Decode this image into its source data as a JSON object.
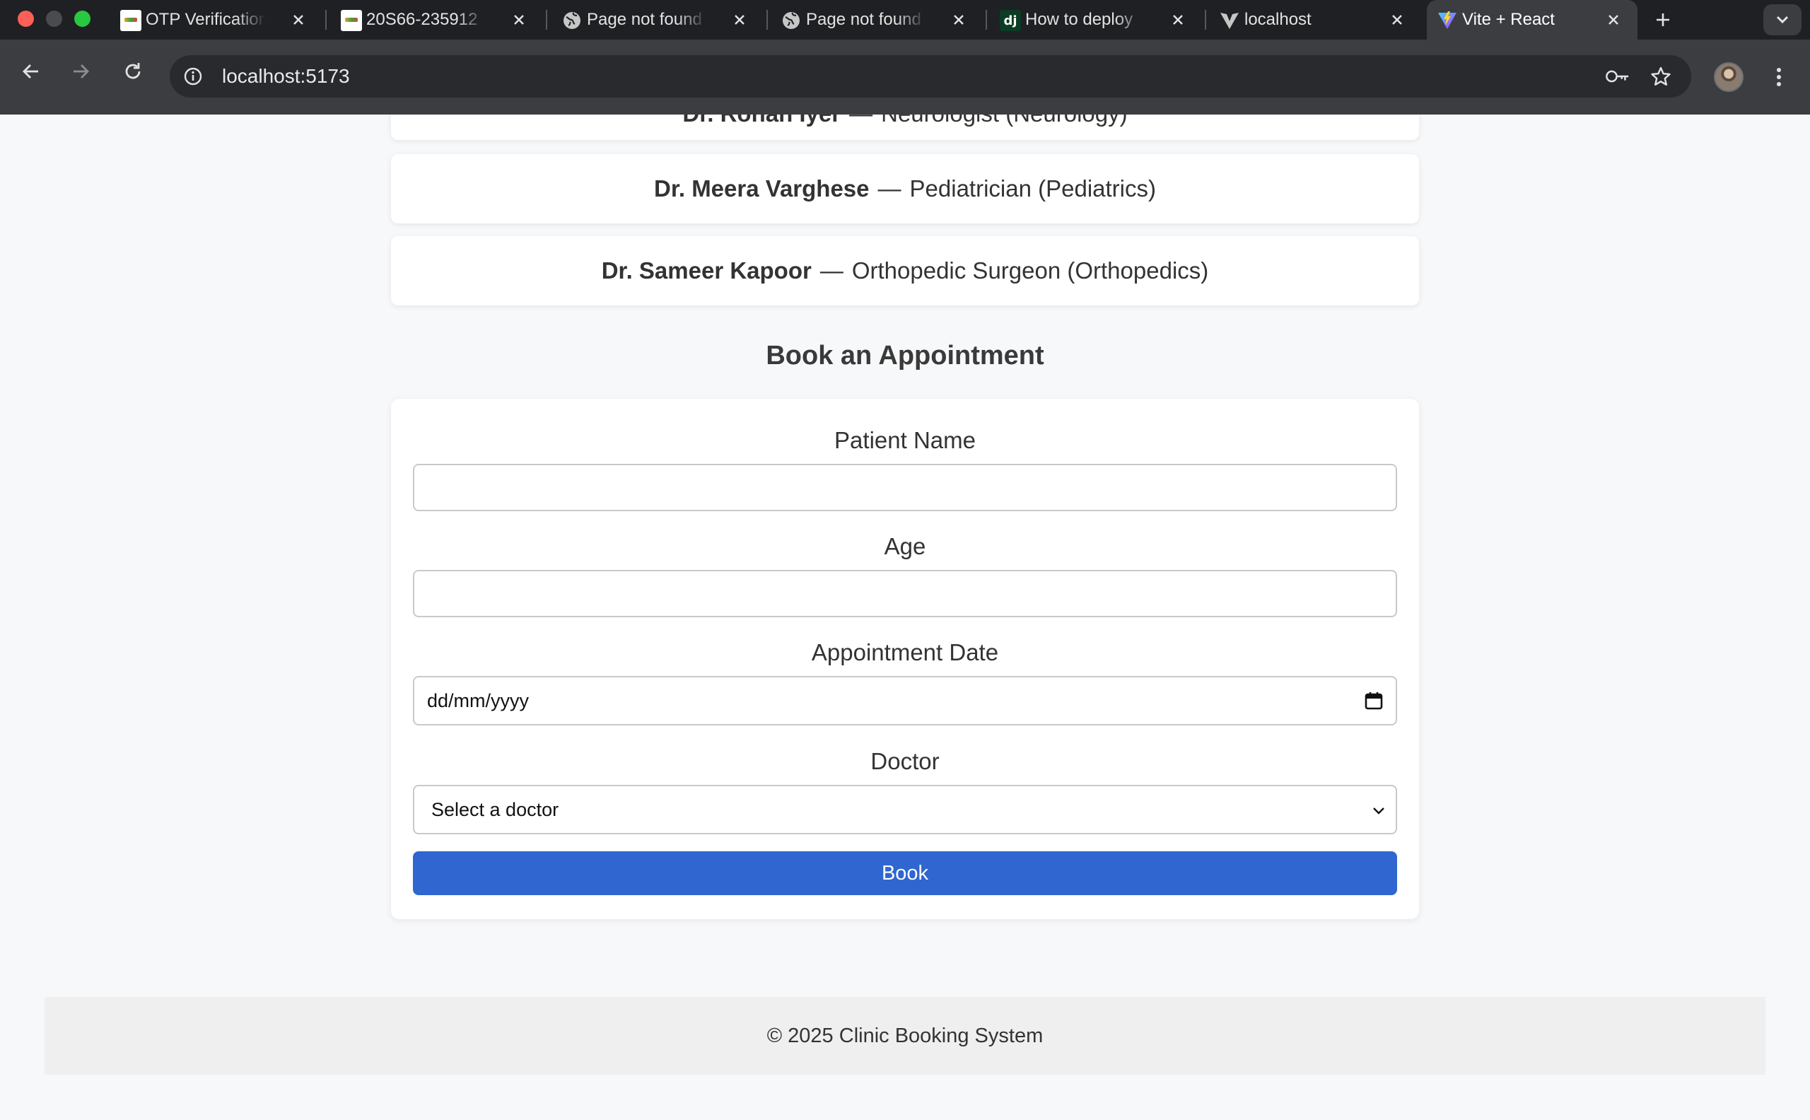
{
  "browser": {
    "tabs": [
      {
        "title": "OTP Verification",
        "favicon": "clinic-logo-icon"
      },
      {
        "title": "20S66-235912",
        "favicon": "clinic-logo-icon"
      },
      {
        "title": "Page not found",
        "favicon": "globe-icon"
      },
      {
        "title": "Page not found",
        "favicon": "globe-icon"
      },
      {
        "title": "How to deploy",
        "favicon": "django-icon",
        "favicon_text": "dj"
      },
      {
        "title": "localhost",
        "favicon": "vite-mono-icon"
      },
      {
        "title": "Vite + React",
        "favicon": "vite-icon",
        "active": true
      }
    ],
    "url": "localhost:5173"
  },
  "doctors": [
    {
      "name": "Dr. Rohan Iyer",
      "role": "Neurologist (Neurology)"
    },
    {
      "name": "Dr. Meera Varghese",
      "role": "Pediatrician (Pediatrics)"
    },
    {
      "name": "Dr. Sameer Kapoor",
      "role": "Orthopedic Surgeon (Orthopedics)"
    }
  ],
  "separator": "—",
  "booking": {
    "title": "Book an Appointment",
    "patient_name_label": "Patient Name",
    "patient_name_value": "",
    "age_label": "Age",
    "age_value": "",
    "date_label": "Appointment Date",
    "date_placeholder": "dd/mm/yyyy",
    "doctor_label": "Doctor",
    "doctor_selected": "Select a doctor",
    "submit_label": "Book"
  },
  "footer": {
    "text": "© 2025 Clinic Booking System"
  },
  "colors": {
    "primary_button": "#2f66d0",
    "page_bg": "#f7f8fa",
    "footer_bg": "#efefef"
  }
}
